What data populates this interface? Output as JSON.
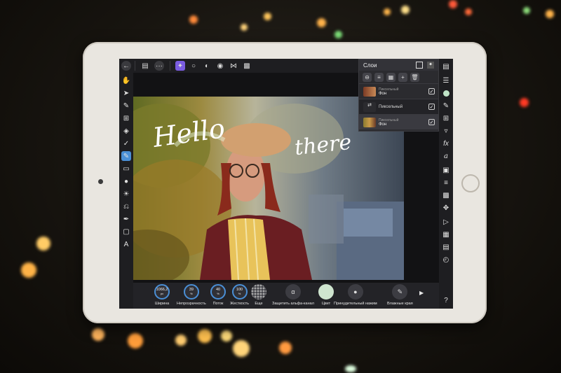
{
  "layers_panel": {
    "title": "Слои",
    "layers": [
      {
        "kind": "Пиксельный",
        "name": "Фон",
        "checked": true
      },
      {
        "inline_name": "Пиксельный",
        "checked": true
      },
      {
        "kind": "Пиксельный",
        "name": "Фон",
        "checked": true
      }
    ]
  },
  "canvas_text": [
    "Hello",
    "there"
  ],
  "context_toolbar": {
    "width_value": "1066,2",
    "width_unit": "px",
    "width_label": "Ширина",
    "opacity_value": "39",
    "opacity_label": "Непрозрачность",
    "flow_value": "40",
    "flow_label": "Поток",
    "hardness_value": "100",
    "hardness_label": "Жесткость",
    "more_label": "Еще",
    "alpha_label": "Защитить альфа-канал",
    "alpha_glyph": "α",
    "color_label": "Цвет",
    "color_value": "#cfe5cf",
    "force_label": "Принудительный нажим",
    "wet_label": "Влажные края",
    "percent": "%"
  },
  "right_tools_fx": "fx",
  "icons": {
    "back": "back-arrow-icon",
    "document": "document-icon",
    "more": "ellipsis-icon",
    "pixel_persona": "pixel-persona-icon",
    "move": "move-tool-icon",
    "brush": "brush-tool-icon",
    "eraser": "eraser-tool-icon",
    "fill": "fill-tool-icon",
    "help": "help-icon"
  },
  "colors": {
    "accent": "#4a8fd6",
    "active_tool": "#7a5ce0",
    "panel_bg": "#2b2b2f",
    "toolbar_bg": "#1e1e21"
  }
}
